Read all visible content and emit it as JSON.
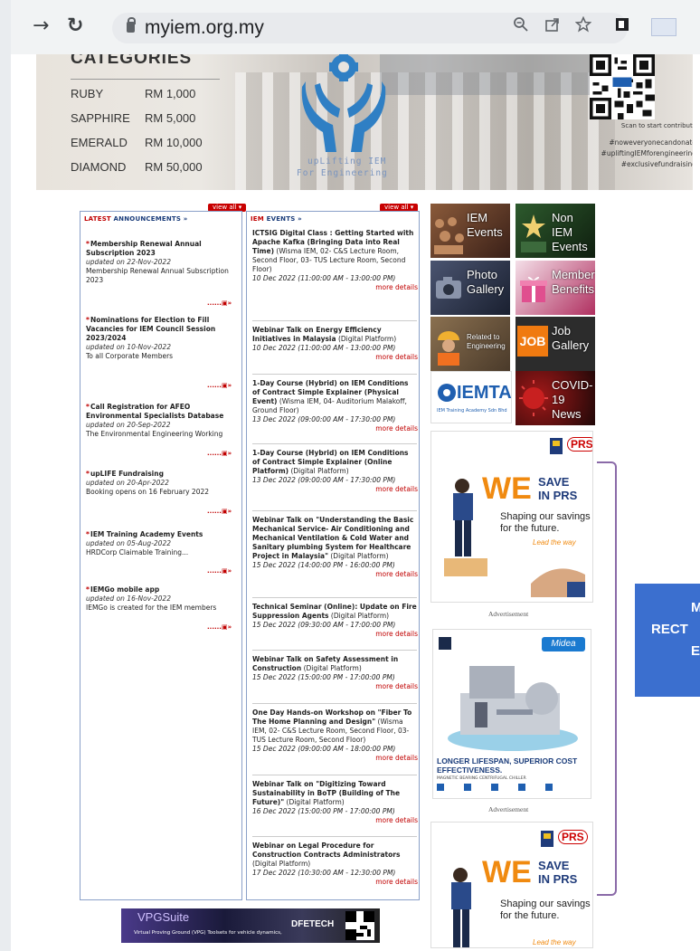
{
  "browser": {
    "url": "myiem.org.my",
    "back_glyph": "→",
    "reload_glyph": "↻",
    "icons": [
      "zoom-icon",
      "share-icon",
      "star-icon",
      "sidebar-icon"
    ]
  },
  "banner": {
    "categories_title": "CATEGORIES",
    "tiers": [
      {
        "name": "RUBY",
        "amount": "RM 1,000"
      },
      {
        "name": "SAPPHIRE",
        "amount": "RM 5,000"
      },
      {
        "name": "EMERALD",
        "amount": "RM 10,000"
      },
      {
        "name": "DIAMOND",
        "amount": "RM 50,000"
      }
    ],
    "tagline_1": "upLifting IEM",
    "tagline_2": "For Engineering",
    "qr_caption": "Scan to start contribute",
    "hashtags": [
      "#noweveryonecandonate",
      "#upliftingIEMforengineering",
      "#exclusivefundraising"
    ]
  },
  "announcements": {
    "view_all": "view all ▾",
    "heading_a": "LATEST",
    "heading_b": " ANNOUNCEMENTS »",
    "items": [
      {
        "title": "Membership Renewal Annual Subscription 2023",
        "date": "updated on 22-Nov-2022",
        "body": "Membership Renewal Annual Subscription 2023"
      },
      {
        "title": "Nominations for Election to Fill Vacancies for IEM Council Session 2023/2024",
        "date": "updated on 10-Nov-2022",
        "body": "To all Corporate Members"
      },
      {
        "title": "Call Registration for AFEO Environmental Specialists Database",
        "date": "updated on 20-Sep-2022",
        "body": "The Environmental Engineering Working"
      },
      {
        "title": "upLIFE Fundraising",
        "date": "updated on 20-Apr-2022",
        "body": "Booking opens on 16 February 2022"
      },
      {
        "title": "IEM Training Academy Events",
        "date": "updated on 05-Aug-2022",
        "body": "HRDCorp Claimable Training..."
      },
      {
        "title": "IEMGo mobile app",
        "date": "updated on 16-Nov-2022",
        "body": "IEMGo is created for the IEM members"
      }
    ],
    "more_glyph": "......▣»"
  },
  "events": {
    "view_all": "view all ▾",
    "heading_a": "IEM",
    "heading_b": " EVENTS »",
    "more": "more details",
    "items": [
      {
        "title": "ICTSIG Digital Class : Getting Started with Apache Kafka (Bringing Data into Real Time)",
        "loc": " (Wisma IEM, 02- C&S Lecture Room, Second Floor, 03- TUS Lecture Room, Second Floor)",
        "date": "10 Dec 2022 (11:00:00 AM - 13:00:00 PM)"
      },
      {
        "title": "Webinar Talk on Energy Efficiency Initiatives in Malaysia",
        "loc": " (Digital Platform)",
        "date": "10 Dec 2022 (11:00:00 AM - 13:00:00 PM)"
      },
      {
        "title": "1-Day Course (Hybrid) on IEM Conditions of Contract Simple Explainer (Physical Event)",
        "loc": " (Wisma IEM, 04- Auditorium Malakoff, Ground Floor)",
        "date": "13 Dec 2022 (09:00:00 AM - 17:30:00 PM)"
      },
      {
        "title": "1-Day Course (Hybrid) on IEM Conditions of Contract Simple Explainer (Online Platform)",
        "loc": " (Digital Platform)",
        "date": "13 Dec 2022 (09:00:00 AM - 17:30:00 PM)"
      },
      {
        "title": "Webinar Talk on \"Understanding the Basic Mechanical Service- Air Conditioning and Mechanical Ventilation & Cold Water and Sanitary plumbing System for Healthcare Project in Malaysia\"",
        "loc": " (Digital Platform)",
        "date": "15 Dec 2022 (14:00:00 PM - 16:00:00 PM)"
      },
      {
        "title": "Technical Seminar (Online): Update on Fire Suppression Agents",
        "loc": " (Digital Platform)",
        "date": "15 Dec 2022 (09:30:00 AM - 17:00:00 PM)"
      },
      {
        "title": "Webinar Talk on Safety Assessment in Construction",
        "loc": " (Digital Platform)",
        "date": "15 Dec 2022 (15:00:00 PM - 17:00:00 PM)"
      },
      {
        "title": "One Day Hands-on Workshop on \"Fiber To The Home Planning and Design\"",
        "loc": " (Wisma IEM, 02- C&S Lecture Room, Second Floor, 03- TUS Lecture Room, Second Floor)",
        "date": "15 Dec 2022 (09:00:00 AM - 18:00:00 PM)"
      },
      {
        "title": "Webinar Talk on \"Digitizing Toward Sustainability in BoTP (Building of The Future)\"",
        "loc": " (Digital Platform)",
        "date": "16 Dec 2022 (15:00:00 PM - 17:00:00 PM)"
      },
      {
        "title": "Webinar on Legal Procedure for Construction Contracts Administrators",
        "loc": " (Digital Platform)",
        "date": "17 Dec 2022 (10:30:00 AM - 12:30:00 PM)"
      }
    ]
  },
  "tiles": [
    {
      "label": "IEM Events",
      "color": "#6a3a2a"
    },
    {
      "label": "Non IEM Events",
      "color": "#1f3b1f"
    },
    {
      "label": "Photo Gallery",
      "color": "#2a3140"
    },
    {
      "label": "Member's Benefits",
      "color": "#9c2350"
    },
    {
      "label": "Related to Engineering",
      "color": "#5a4a3a"
    },
    {
      "label": "Job Gallery",
      "color": "#2c2c2c"
    },
    {
      "label": "COVID-19 News",
      "color": "#2a0b0b"
    }
  ],
  "iemta": {
    "name": "IEMTA",
    "sub": "IEM Training Academy Sdn Bhd"
  },
  "ads": {
    "prs_brand": "PRS",
    "we": "WE",
    "save": "SAVE",
    "in_prs": "IN PRS",
    "shaping": "Shaping our savings for the future.",
    "lead": "Lead the way",
    "caption": "Advertisement",
    "midea": "Midea",
    "midea_head": "LONGER LIFESPAN, SUPERIOR COST EFFECTIVENESS.",
    "midea_sub": "MAGNETIC BEARING CENTRIFUGAL CHILLER"
  },
  "callout": {
    "lines": [
      "M",
      "RECT",
      "E"
    ]
  },
  "bottom_banner": {
    "left": "VPGSuite",
    "tag": "Virtual Proving Ground (VPG) Toolsets for vehicle dynamics,",
    "right": "DFETECH"
  }
}
